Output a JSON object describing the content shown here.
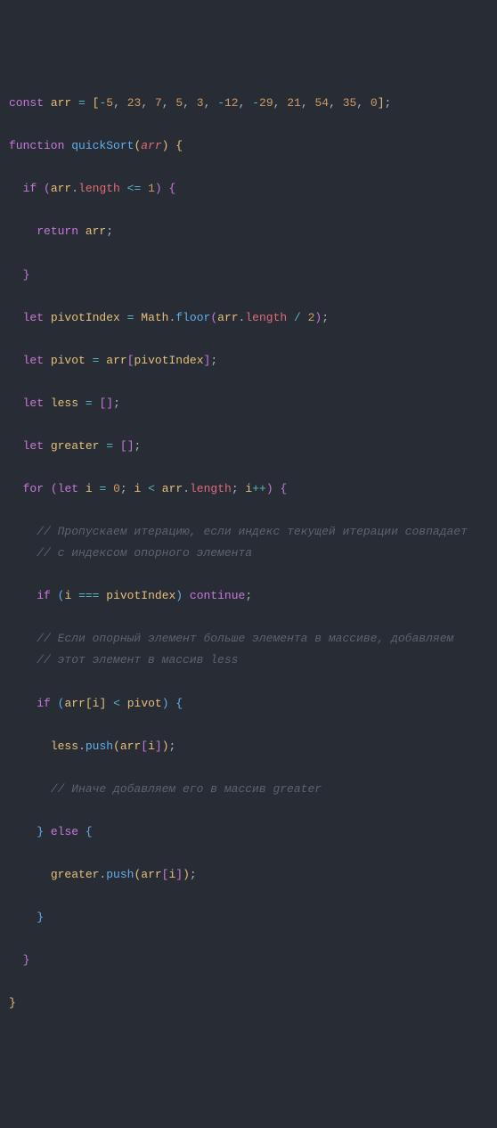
{
  "code": {
    "lines": [
      {
        "indent": 0,
        "tokens": [
          {
            "t": "const ",
            "c": "kw"
          },
          {
            "t": "arr",
            "c": "var"
          },
          {
            "t": " ",
            "c": "str"
          },
          {
            "t": "=",
            "c": "op"
          },
          {
            "t": " ",
            "c": "str"
          },
          {
            "t": "[",
            "c": "brace-y"
          },
          {
            "t": "-",
            "c": "op"
          },
          {
            "t": "5",
            "c": "num"
          },
          {
            "t": ", ",
            "c": "punct"
          },
          {
            "t": "23",
            "c": "num"
          },
          {
            "t": ", ",
            "c": "punct"
          },
          {
            "t": "7",
            "c": "num"
          },
          {
            "t": ", ",
            "c": "punct"
          },
          {
            "t": "5",
            "c": "num"
          },
          {
            "t": ", ",
            "c": "punct"
          },
          {
            "t": "3",
            "c": "num"
          },
          {
            "t": ", ",
            "c": "punct"
          },
          {
            "t": "-",
            "c": "op"
          },
          {
            "t": "12",
            "c": "num"
          },
          {
            "t": ", ",
            "c": "punct"
          },
          {
            "t": "-",
            "c": "op"
          },
          {
            "t": "29",
            "c": "num"
          },
          {
            "t": ", ",
            "c": "punct"
          },
          {
            "t": "21",
            "c": "num"
          },
          {
            "t": ", ",
            "c": "punct"
          },
          {
            "t": "54",
            "c": "num"
          },
          {
            "t": ", ",
            "c": "punct"
          },
          {
            "t": "35",
            "c": "num"
          },
          {
            "t": ", ",
            "c": "punct"
          },
          {
            "t": "0",
            "c": "num"
          },
          {
            "t": "]",
            "c": "brace-y"
          },
          {
            "t": ";",
            "c": "punct"
          }
        ]
      },
      {
        "indent": 0,
        "tokens": []
      },
      {
        "indent": 0,
        "tokens": [
          {
            "t": "function ",
            "c": "kw"
          },
          {
            "t": "quickSort",
            "c": "fn"
          },
          {
            "t": "(",
            "c": "brace-y"
          },
          {
            "t": "arr",
            "c": "param"
          },
          {
            "t": ")",
            "c": "brace-y"
          },
          {
            "t": " ",
            "c": "str"
          },
          {
            "t": "{",
            "c": "brace-y"
          }
        ]
      },
      {
        "indent": 0,
        "tokens": []
      },
      {
        "indent": 1,
        "tokens": [
          {
            "t": "if ",
            "c": "kw"
          },
          {
            "t": "(",
            "c": "brace"
          },
          {
            "t": "arr",
            "c": "var"
          },
          {
            "t": ".",
            "c": "punct"
          },
          {
            "t": "length",
            "c": "prop"
          },
          {
            "t": " ",
            "c": "str"
          },
          {
            "t": "<=",
            "c": "op"
          },
          {
            "t": " ",
            "c": "str"
          },
          {
            "t": "1",
            "c": "num"
          },
          {
            "t": ")",
            "c": "brace"
          },
          {
            "t": " ",
            "c": "str"
          },
          {
            "t": "{",
            "c": "brace"
          }
        ]
      },
      {
        "indent": 0,
        "tokens": []
      },
      {
        "indent": 2,
        "tokens": [
          {
            "t": "return ",
            "c": "kw"
          },
          {
            "t": "arr",
            "c": "var"
          },
          {
            "t": ";",
            "c": "punct"
          }
        ]
      },
      {
        "indent": 0,
        "tokens": []
      },
      {
        "indent": 1,
        "tokens": [
          {
            "t": "}",
            "c": "brace"
          }
        ]
      },
      {
        "indent": 0,
        "tokens": []
      },
      {
        "indent": 1,
        "tokens": [
          {
            "t": "let ",
            "c": "kw"
          },
          {
            "t": "pivotIndex",
            "c": "var"
          },
          {
            "t": " ",
            "c": "str"
          },
          {
            "t": "=",
            "c": "op"
          },
          {
            "t": " ",
            "c": "str"
          },
          {
            "t": "Math",
            "c": "this"
          },
          {
            "t": ".",
            "c": "punct"
          },
          {
            "t": "floor",
            "c": "fn"
          },
          {
            "t": "(",
            "c": "brace"
          },
          {
            "t": "arr",
            "c": "var"
          },
          {
            "t": ".",
            "c": "punct"
          },
          {
            "t": "length",
            "c": "prop"
          },
          {
            "t": " ",
            "c": "str"
          },
          {
            "t": "/",
            "c": "op"
          },
          {
            "t": " ",
            "c": "str"
          },
          {
            "t": "2",
            "c": "num"
          },
          {
            "t": ")",
            "c": "brace"
          },
          {
            "t": ";",
            "c": "punct"
          }
        ]
      },
      {
        "indent": 0,
        "tokens": []
      },
      {
        "indent": 1,
        "tokens": [
          {
            "t": "let ",
            "c": "kw"
          },
          {
            "t": "pivot",
            "c": "var"
          },
          {
            "t": " ",
            "c": "str"
          },
          {
            "t": "=",
            "c": "op"
          },
          {
            "t": " ",
            "c": "str"
          },
          {
            "t": "arr",
            "c": "var"
          },
          {
            "t": "[",
            "c": "brace"
          },
          {
            "t": "pivotIndex",
            "c": "var"
          },
          {
            "t": "]",
            "c": "brace"
          },
          {
            "t": ";",
            "c": "punct"
          }
        ]
      },
      {
        "indent": 0,
        "tokens": []
      },
      {
        "indent": 1,
        "tokens": [
          {
            "t": "let ",
            "c": "kw"
          },
          {
            "t": "less",
            "c": "var"
          },
          {
            "t": " ",
            "c": "str"
          },
          {
            "t": "=",
            "c": "op"
          },
          {
            "t": " ",
            "c": "str"
          },
          {
            "t": "[",
            "c": "brace"
          },
          {
            "t": "]",
            "c": "brace"
          },
          {
            "t": ";",
            "c": "punct"
          }
        ]
      },
      {
        "indent": 0,
        "tokens": []
      },
      {
        "indent": 1,
        "tokens": [
          {
            "t": "let ",
            "c": "kw"
          },
          {
            "t": "greater",
            "c": "var"
          },
          {
            "t": " ",
            "c": "str"
          },
          {
            "t": "=",
            "c": "op"
          },
          {
            "t": " ",
            "c": "str"
          },
          {
            "t": "[",
            "c": "brace"
          },
          {
            "t": "]",
            "c": "brace"
          },
          {
            "t": ";",
            "c": "punct"
          }
        ]
      },
      {
        "indent": 0,
        "tokens": []
      },
      {
        "indent": 1,
        "tokens": [
          {
            "t": "for ",
            "c": "kw"
          },
          {
            "t": "(",
            "c": "brace"
          },
          {
            "t": "let ",
            "c": "kw"
          },
          {
            "t": "i",
            "c": "var"
          },
          {
            "t": " ",
            "c": "str"
          },
          {
            "t": "=",
            "c": "op"
          },
          {
            "t": " ",
            "c": "str"
          },
          {
            "t": "0",
            "c": "num"
          },
          {
            "t": "; ",
            "c": "punct"
          },
          {
            "t": "i",
            "c": "var"
          },
          {
            "t": " ",
            "c": "str"
          },
          {
            "t": "<",
            "c": "op"
          },
          {
            "t": " ",
            "c": "str"
          },
          {
            "t": "arr",
            "c": "var"
          },
          {
            "t": ".",
            "c": "punct"
          },
          {
            "t": "length",
            "c": "prop"
          },
          {
            "t": "; ",
            "c": "punct"
          },
          {
            "t": "i",
            "c": "var"
          },
          {
            "t": "++",
            "c": "op"
          },
          {
            "t": ")",
            "c": "brace"
          },
          {
            "t": " ",
            "c": "str"
          },
          {
            "t": "{",
            "c": "brace"
          }
        ]
      },
      {
        "indent": 0,
        "tokens": []
      },
      {
        "indent": 2,
        "tokens": [
          {
            "t": "// Пропускаем итерацию, если индекс текущей итерации совпадает",
            "c": "comment"
          }
        ]
      },
      {
        "indent": 2,
        "tokens": [
          {
            "t": "// с индексом опорного элемента",
            "c": "comment"
          }
        ]
      },
      {
        "indent": 0,
        "tokens": []
      },
      {
        "indent": 2,
        "tokens": [
          {
            "t": "if ",
            "c": "kw"
          },
          {
            "t": "(",
            "c": "brace-b"
          },
          {
            "t": "i",
            "c": "var"
          },
          {
            "t": " ",
            "c": "str"
          },
          {
            "t": "===",
            "c": "op"
          },
          {
            "t": " ",
            "c": "str"
          },
          {
            "t": "pivotIndex",
            "c": "var"
          },
          {
            "t": ")",
            "c": "brace-b"
          },
          {
            "t": " ",
            "c": "str"
          },
          {
            "t": "continue",
            "c": "kw"
          },
          {
            "t": ";",
            "c": "punct"
          }
        ]
      },
      {
        "indent": 0,
        "tokens": []
      },
      {
        "indent": 2,
        "tokens": [
          {
            "t": "// Если опорный элемент больше элемента в массиве, добавляем",
            "c": "comment"
          }
        ]
      },
      {
        "indent": 2,
        "tokens": [
          {
            "t": "// этот элемент в массив less",
            "c": "comment"
          }
        ]
      },
      {
        "indent": 0,
        "tokens": []
      },
      {
        "indent": 2,
        "tokens": [
          {
            "t": "if ",
            "c": "kw"
          },
          {
            "t": "(",
            "c": "brace-b"
          },
          {
            "t": "arr",
            "c": "var"
          },
          {
            "t": "[",
            "c": "brace-y"
          },
          {
            "t": "i",
            "c": "var"
          },
          {
            "t": "]",
            "c": "brace-y"
          },
          {
            "t": " ",
            "c": "str"
          },
          {
            "t": "<",
            "c": "op"
          },
          {
            "t": " ",
            "c": "str"
          },
          {
            "t": "pivot",
            "c": "var"
          },
          {
            "t": ")",
            "c": "brace-b"
          },
          {
            "t": " ",
            "c": "str"
          },
          {
            "t": "{",
            "c": "brace-b"
          }
        ]
      },
      {
        "indent": 0,
        "tokens": []
      },
      {
        "indent": 3,
        "tokens": [
          {
            "t": "less",
            "c": "var"
          },
          {
            "t": ".",
            "c": "punct"
          },
          {
            "t": "push",
            "c": "fn"
          },
          {
            "t": "(",
            "c": "brace-y"
          },
          {
            "t": "arr",
            "c": "var"
          },
          {
            "t": "[",
            "c": "brace"
          },
          {
            "t": "i",
            "c": "var"
          },
          {
            "t": "]",
            "c": "brace"
          },
          {
            "t": ")",
            "c": "brace-y"
          },
          {
            "t": ";",
            "c": "punct"
          }
        ]
      },
      {
        "indent": 0,
        "tokens": []
      },
      {
        "indent": 3,
        "tokens": [
          {
            "t": "// Иначе добавляем его в массив greater",
            "c": "comment"
          }
        ]
      },
      {
        "indent": 0,
        "tokens": []
      },
      {
        "indent": 2,
        "tokens": [
          {
            "t": "}",
            "c": "brace-b"
          },
          {
            "t": " ",
            "c": "str"
          },
          {
            "t": "else ",
            "c": "kw"
          },
          {
            "t": "{",
            "c": "brace-b"
          }
        ]
      },
      {
        "indent": 0,
        "tokens": []
      },
      {
        "indent": 3,
        "tokens": [
          {
            "t": "greater",
            "c": "var"
          },
          {
            "t": ".",
            "c": "punct"
          },
          {
            "t": "push",
            "c": "fn"
          },
          {
            "t": "(",
            "c": "brace-y"
          },
          {
            "t": "arr",
            "c": "var"
          },
          {
            "t": "[",
            "c": "brace"
          },
          {
            "t": "i",
            "c": "var"
          },
          {
            "t": "]",
            "c": "brace"
          },
          {
            "t": ")",
            "c": "brace-y"
          },
          {
            "t": ";",
            "c": "punct"
          }
        ]
      },
      {
        "indent": 0,
        "tokens": []
      },
      {
        "indent": 2,
        "tokens": [
          {
            "t": "}",
            "c": "brace-b"
          }
        ]
      },
      {
        "indent": 0,
        "tokens": []
      },
      {
        "indent": 1,
        "tokens": [
          {
            "t": "}",
            "c": "brace"
          }
        ]
      },
      {
        "indent": 0,
        "tokens": []
      },
      {
        "indent": 0,
        "tokens": [
          {
            "t": "}",
            "c": "brace-y"
          }
        ]
      }
    ]
  }
}
